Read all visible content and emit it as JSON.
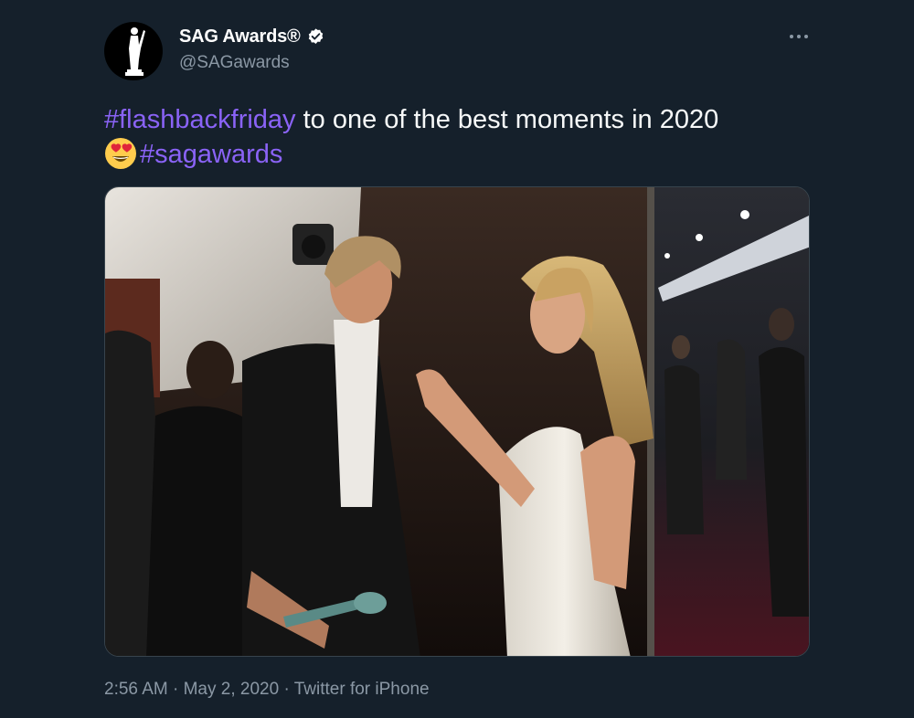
{
  "author": {
    "display_name": "SAG Awards®",
    "handle": "@SAGawards",
    "verified": true,
    "avatar_icon": "sag-statuette-logo"
  },
  "tweet": {
    "segments": [
      {
        "type": "hashtag",
        "text": "#flashbackfriday"
      },
      {
        "type": "text",
        "text": " to one of the best moments in 2020"
      },
      {
        "type": "emoji",
        "name": "heart-eyes-emoji"
      },
      {
        "type": "hashtag",
        "text": "#sagawards"
      }
    ],
    "media_description": "photo"
  },
  "footer": {
    "time": "2:56 AM",
    "separator": " · ",
    "date": "May 2, 2020",
    "source": "Twitter for iPhone"
  },
  "colors": {
    "background": "#15202b",
    "hashtag": "#8a63f6",
    "secondary_text": "#8b98a5",
    "verified_badge": "#ffffff"
  }
}
